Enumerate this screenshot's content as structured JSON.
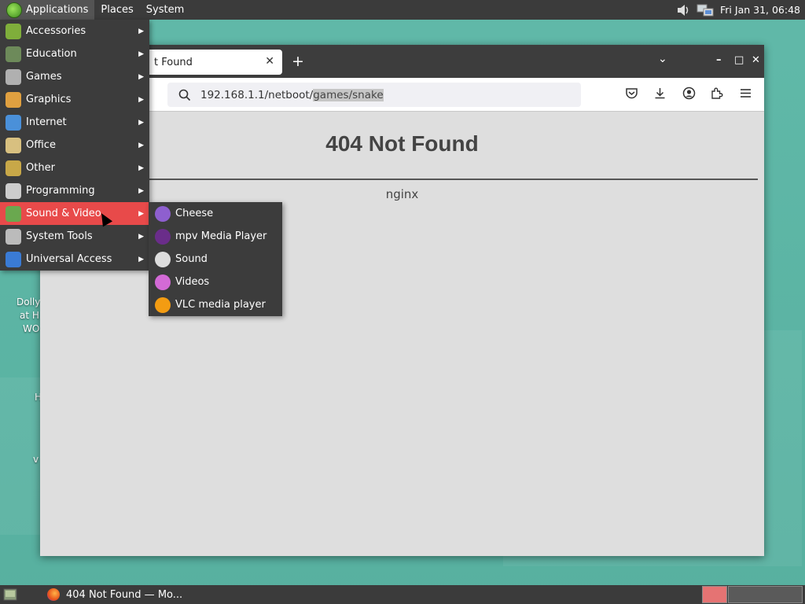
{
  "top_panel": {
    "menus": [
      "Applications",
      "Places",
      "System"
    ],
    "clock": "Fri Jan 31, 06:48"
  },
  "desktop": {
    "labels": [
      "Dolly",
      "at H",
      "WO",
      "H",
      "v"
    ]
  },
  "browser": {
    "tab_title": "t Found",
    "url_prefix": "192.168.1.1/netboot/",
    "url_selected": "games/snake",
    "page": {
      "heading": "404 Not Found",
      "server": "nginx"
    }
  },
  "apps_menu": {
    "items": [
      {
        "label": "Accessories",
        "icon": "accessories-icon"
      },
      {
        "label": "Education",
        "icon": "education-icon"
      },
      {
        "label": "Games",
        "icon": "games-icon"
      },
      {
        "label": "Graphics",
        "icon": "graphics-icon"
      },
      {
        "label": "Internet",
        "icon": "internet-icon"
      },
      {
        "label": "Office",
        "icon": "office-icon"
      },
      {
        "label": "Other",
        "icon": "other-icon"
      },
      {
        "label": "Programming",
        "icon": "programming-icon"
      },
      {
        "label": "Sound & Video",
        "icon": "sound-video-icon"
      },
      {
        "label": "System Tools",
        "icon": "system-tools-icon"
      },
      {
        "label": "Universal Access",
        "icon": "universal-access-icon"
      }
    ],
    "active_index": 8
  },
  "submenu": {
    "items": [
      {
        "label": "Cheese",
        "icon": "cheese-icon"
      },
      {
        "label": "mpv Media Player",
        "icon": "mpv-icon"
      },
      {
        "label": "Sound",
        "icon": "sound-icon"
      },
      {
        "label": "Videos",
        "icon": "videos-icon"
      },
      {
        "label": "VLC media player",
        "icon": "vlc-icon"
      }
    ]
  },
  "taskbar": {
    "task_label": "404 Not Found — Mo..."
  },
  "colors": {
    "menu_bg": "#3c3c3c",
    "menu_active": "#e84a4a",
    "desktop": "#5ab6a5"
  }
}
